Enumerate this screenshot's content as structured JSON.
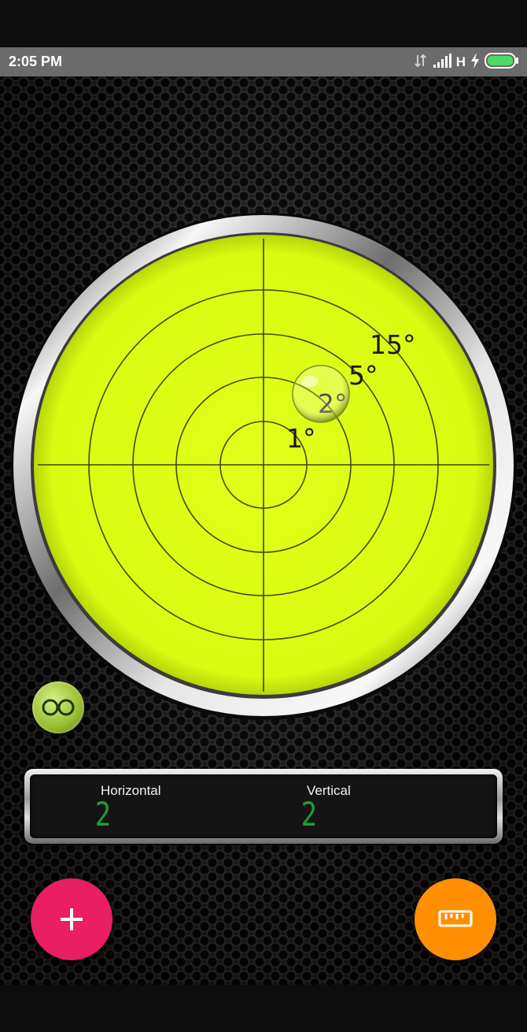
{
  "status_bar": {
    "time": "2:05 PM",
    "network_type": "H",
    "icons": [
      "data-transfer-icon",
      "signal-icon",
      "charging-icon",
      "battery-icon"
    ],
    "battery_color": "#4cd964"
  },
  "level": {
    "ring_labels": [
      "1°",
      "2°",
      "5°",
      "15°"
    ],
    "face_color": "#deff12",
    "bubble": {
      "tilt_degrees": 2,
      "direction": "upper-right"
    }
  },
  "lock_button": {
    "icon": "infinity-icon"
  },
  "readout": {
    "horizontal_label": "Horizontal",
    "horizontal_value": "2",
    "vertical_label": "Vertical",
    "vertical_value": "2",
    "digit_color": "#1f9e38"
  },
  "buttons": {
    "add": {
      "icon": "plus-icon",
      "color": "#e91e63"
    },
    "measure": {
      "icon": "ruler-icon",
      "color": "#ff8f00"
    }
  }
}
